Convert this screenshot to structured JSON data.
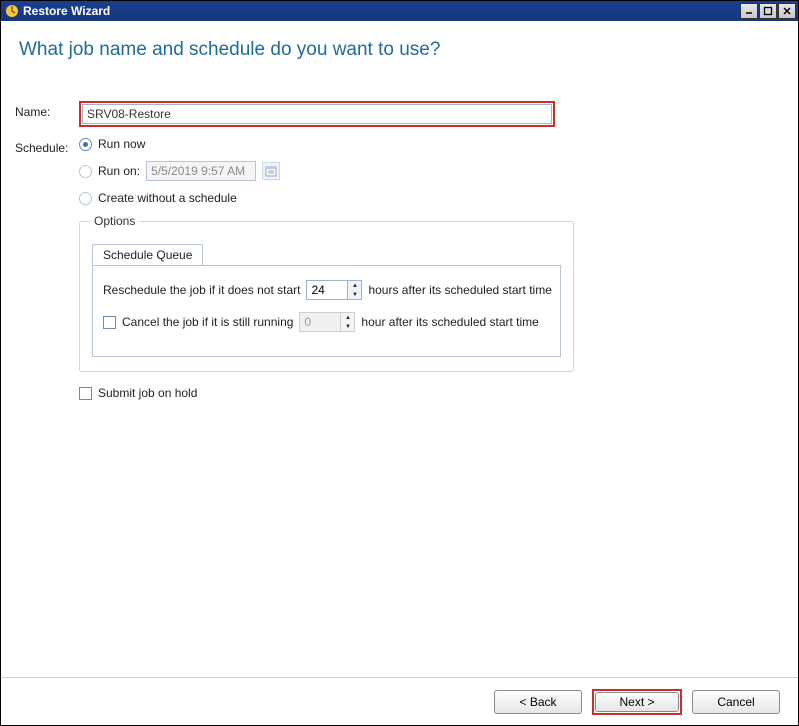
{
  "window": {
    "title": "Restore Wizard"
  },
  "page": {
    "heading": "What job name and schedule do you want to use?"
  },
  "form": {
    "name_label": "Name:",
    "name_value": "SRV08-Restore",
    "schedule_label": "Schedule:",
    "radios": {
      "run_now": "Run now",
      "run_on": "Run on:",
      "run_on_value": "5/5/2019 9:57 AM",
      "create_noschedule": "Create without a schedule"
    },
    "selected_radio": "run_now"
  },
  "options": {
    "legend": "Options",
    "tab_label": "Schedule Queue",
    "reschedule_prefix": "Reschedule the job if it does not start",
    "reschedule_value": "24",
    "reschedule_suffix": "hours after its scheduled start time",
    "cancel_label": "Cancel the job if it is still running",
    "cancel_value": "0",
    "cancel_suffix": "hour after its scheduled start time",
    "cancel_checked": false
  },
  "submit_hold": {
    "label": "Submit job on hold",
    "checked": false
  },
  "footer": {
    "back": "< Back",
    "next": "Next >",
    "cancel": "Cancel"
  }
}
